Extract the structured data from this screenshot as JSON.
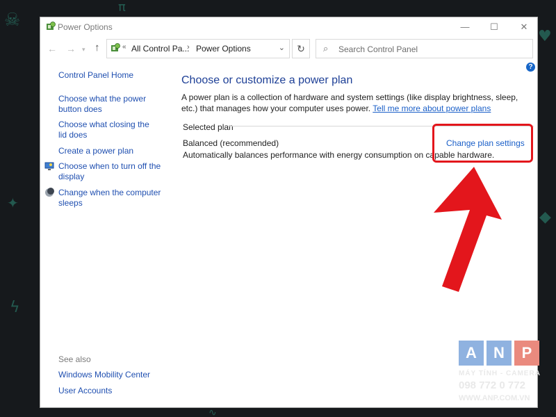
{
  "window": {
    "title": "Power Options",
    "minimize": "—",
    "maximize": "☐",
    "close": "✕"
  },
  "nav": {
    "back": "←",
    "forward": "→",
    "recent": "▾",
    "up": "↑",
    "address_chevron": "«",
    "breadcrumb": [
      "All Control Pa...",
      "Power Options"
    ],
    "crumb_separator": "›",
    "address_dropdown": "⌄",
    "refresh": "↻",
    "search_placeholder": "Search Control Panel"
  },
  "help": "?",
  "sidebar": {
    "home": "Control Panel Home",
    "links": [
      "Choose what the power button does",
      "Choose what closing the lid does",
      "Create a power plan",
      "Choose when to turn off the display",
      "Change when the computer sleeps"
    ],
    "see_also_label": "See also",
    "see_also": [
      "Windows Mobility Center",
      "User Accounts"
    ]
  },
  "main": {
    "title": "Choose or customize a power plan",
    "description": "A power plan is a collection of hardware and system settings (like display brightness, sleep, etc.) that manages how your computer uses power.",
    "description_link": "Tell me more about power plans",
    "selected_plan_label": "Selected plan",
    "plan": {
      "name": "Balanced (recommended)",
      "description": "Automatically balances performance with energy consumption on capable hardware.",
      "change_link": "Change plan settings"
    }
  },
  "annotation": {
    "highlight_color": "#e3161c"
  },
  "watermark": {
    "letters": [
      "A",
      "N",
      "P"
    ],
    "tagline": "MÁY TÍNH - CAMERA",
    "phone": "098 772 0 772",
    "url": "WWW.ANP.COM.VN"
  }
}
